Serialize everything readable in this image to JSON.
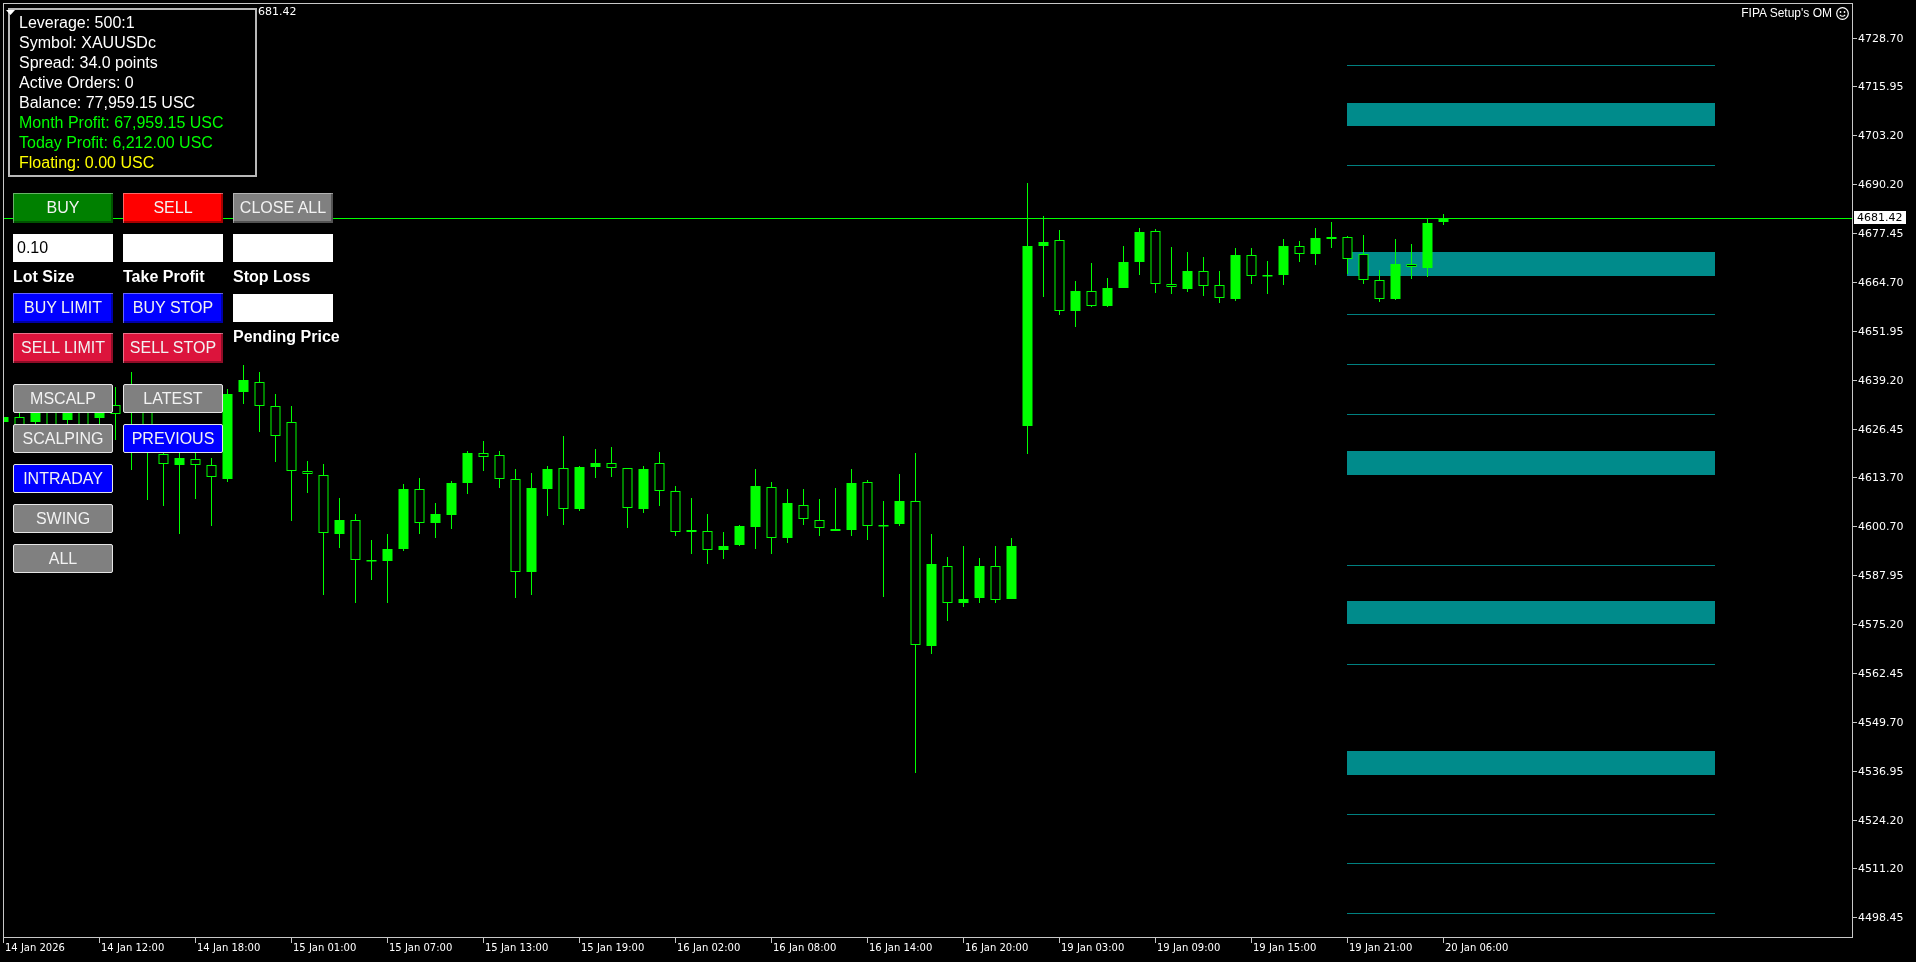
{
  "info_panel": {
    "lines": [
      {
        "text": "Leverage: 500:1",
        "color": "#ffffff"
      },
      {
        "text": "Symbol: XAUUSDc",
        "color": "#ffffff"
      },
      {
        "text": "Spread: 34.0 points",
        "color": "#ffffff"
      },
      {
        "text": "Active Orders: 0",
        "color": "#ffffff"
      },
      {
        "text": "Balance: 77,959.15 USC",
        "color": "#ffffff"
      },
      {
        "text": "Month Profit: 67,959.15 USC",
        "color": "#00ff00"
      },
      {
        "text": "Today Profit: 6,212.00 USC",
        "color": "#00ff00"
      },
      {
        "text": "Floating: 0.00 USC",
        "color": "#ffff00"
      }
    ]
  },
  "chart": {
    "title_fragment": "681.42",
    "indicator_label": "FIPA Setup's OM",
    "current_price": "4681.42",
    "price_ticks": [
      "4728.70",
      "4715.95",
      "4703.20",
      "4690.20",
      "4677.45",
      "4664.70",
      "4651.95",
      "4639.20",
      "4626.45",
      "4613.70",
      "4600.70",
      "4587.95",
      "4575.20",
      "4562.45",
      "4549.70",
      "4536.95",
      "4524.20",
      "4511.20",
      "4498.45"
    ],
    "time_ticks": [
      "14 Jan 2026",
      "14 Jan 12:00",
      "14 Jan 18:00",
      "15 Jan 01:00",
      "15 Jan 07:00",
      "15 Jan 13:00",
      "15 Jan 19:00",
      "16 Jan 02:00",
      "16 Jan 08:00",
      "16 Jan 14:00",
      "16 Jan 20:00",
      "19 Jan 03:00",
      "19 Jan 09:00",
      "19 Jan 15:00",
      "19 Jan 21:00",
      "20 Jan 06:00"
    ]
  },
  "trade_panel": {
    "market_buttons": [
      {
        "label": "BUY",
        "color": "#008000"
      },
      {
        "label": "SELL",
        "color": "#ff0000"
      },
      {
        "label": "CLOSE ALL",
        "color": "#808080"
      }
    ],
    "fields": [
      {
        "label": "Lot Size",
        "value": "0.10"
      },
      {
        "label": "Take Profit"
      },
      {
        "label": "Stop Loss"
      }
    ],
    "pending_buttons": [
      {
        "label": "BUY LIMIT",
        "color": "#0000ff"
      },
      {
        "label": "BUY STOP",
        "color": "#0000ff"
      },
      {
        "label": "SELL LIMIT",
        "color": "#dc143c"
      },
      {
        "label": "SELL STOP",
        "color": "#dc143c"
      }
    ],
    "pending_field": {
      "label": "Pending Price"
    },
    "style_filters": [
      {
        "label": "MSCALP",
        "selected": false
      },
      {
        "label": "SCALPING",
        "selected": false
      },
      {
        "label": "INTRADAY",
        "selected": true
      },
      {
        "label": "SWING",
        "selected": false
      },
      {
        "label": "ALL",
        "selected": false
      }
    ],
    "period_filters": [
      {
        "label": "LATEST",
        "selected": false
      },
      {
        "label": "PREVIOUS",
        "selected": true
      }
    ]
  }
}
